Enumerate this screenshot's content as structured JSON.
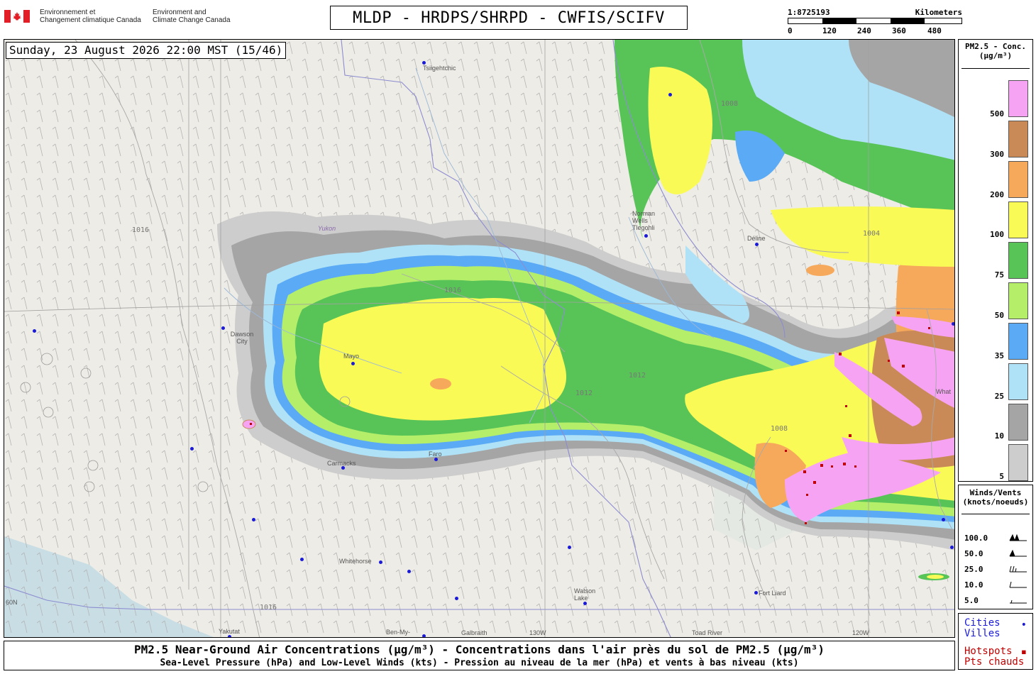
{
  "header": {
    "agency_fr": [
      "Environnement et",
      "Changement climatique Canada"
    ],
    "agency_en": [
      "Environment and",
      "Climate Change Canada"
    ],
    "title": "MLDP - HRDPS/SHRPD - CWFIS/SCIFV"
  },
  "scale": {
    "ratio": "1:8725193",
    "unit": "Kilometers",
    "ticks": [
      "0",
      "120",
      "240",
      "360",
      "480"
    ]
  },
  "map": {
    "timestamp": "Sunday, 23 August 2026 22:00 MST (15/46)",
    "places": [
      {
        "name": "Tsiigehtchic"
      },
      {
        "name": "Dawson City"
      },
      {
        "name": "Mayo"
      },
      {
        "name": "Carmacks"
      },
      {
        "name": "Faro"
      },
      {
        "name": "Whitehorse"
      },
      {
        "name": "Watson Lake"
      },
      {
        "name": "Fort Liard"
      },
      {
        "name": "Norman Wells Tlegohli"
      },
      {
        "name": "Déline"
      },
      {
        "name": "Yakutat"
      },
      {
        "name": "Ben-My-"
      },
      {
        "name": "Galbraith"
      },
      {
        "name": "Toad River"
      },
      {
        "name": "What"
      },
      {
        "name": "Yukon"
      }
    ],
    "meridians": [
      "130W",
      "120W",
      "60N"
    ],
    "isobars": [
      "1016",
      "1012",
      "1008",
      "1004"
    ]
  },
  "legend": {
    "title": [
      "PM2.5 - Conc.",
      "(µg/m³)"
    ],
    "colors": {
      "c500": "#f7a3f4",
      "c300": "#c98a58",
      "c200": "#f7a95b",
      "c100": "#fafa57",
      "c75": "#58c458",
      "c50": "#b5ef6a",
      "c35": "#5aaaf5",
      "c25": "#b0e2f7",
      "c10": "#a5a5a5",
      "c5": "#cdcdcd"
    },
    "labels": [
      "500",
      "300",
      "200",
      "100",
      "75",
      "50",
      "35",
      "25",
      "10",
      "5"
    ]
  },
  "winds": {
    "title": [
      "Winds/Vents",
      "(knots/noeuds)"
    ],
    "labels": [
      "100.0",
      "50.0",
      "25.0",
      "10.0",
      "5.0"
    ]
  },
  "points": {
    "cities": [
      "Cities",
      "Villes"
    ],
    "hotspots": [
      "Hotspots",
      "Pts chauds"
    ]
  },
  "footer": {
    "line1": "PM2.5 Near-Ground Air Concentrations (µg/m³) - Concentrations dans l'air près du sol de PM2.5 (µg/m³)",
    "line2": "Sea-Level Pressure (hPa) and Low-Level Winds (kts) - Pression au niveau de la mer (hPa) et vents à bas niveau (kts)"
  }
}
